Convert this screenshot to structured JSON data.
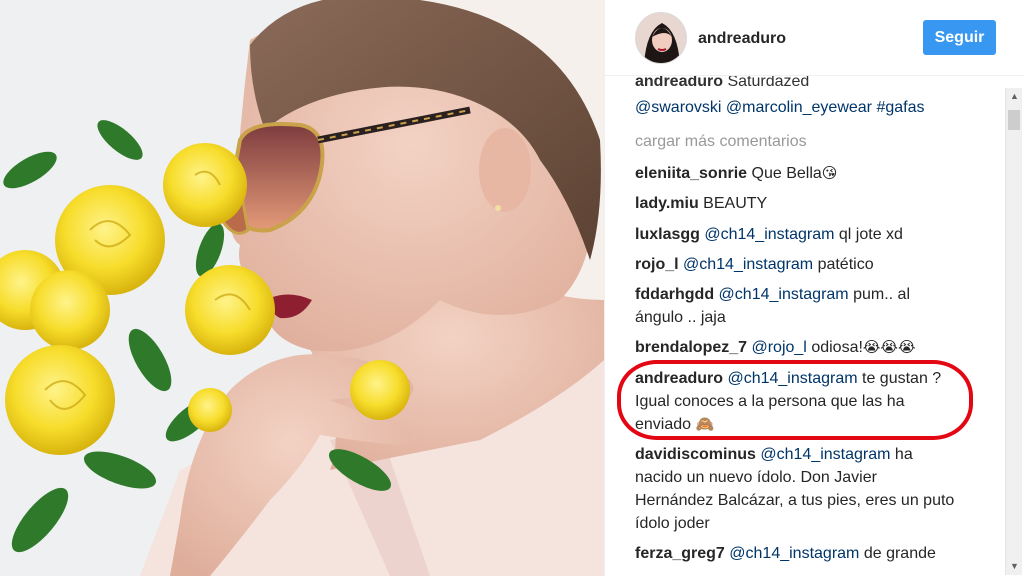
{
  "header": {
    "username": "andreaduro",
    "follow_label": "Seguir"
  },
  "caption_top": {
    "username": "andreaduro",
    "text": "Saturdazed ",
    "mentions": "@swarovski @marcolin_eyewear #gafas"
  },
  "load_more": "cargar más comentarios",
  "comments": [
    {
      "user": "eleniita_sonrie",
      "text": "Que Bella",
      "emoji": "😘"
    },
    {
      "user": "lady.miu",
      "text": "BEAUTY"
    },
    {
      "user": "luxlasgg",
      "mention": "@ch14_instagram",
      "text": "ql jote xd"
    },
    {
      "user": "rojo_l",
      "mention": "@ch14_instagram",
      "text": "patético"
    },
    {
      "user": "fddarhgdd",
      "mention": "@ch14_instagram",
      "text": "pum.. al",
      "text2": "ángulo .. jaja"
    },
    {
      "user": "brendalopez_7",
      "mention": "@rojo_l",
      "text": "odiosa!",
      "emoji": "😭😭😭"
    },
    {
      "user": "andreaduro",
      "mention": "@ch14_instagram",
      "text": "te gustan ?",
      "text2": "Igual conoces a la persona que las ha",
      "text3": "enviado",
      "emoji": "🙈"
    },
    {
      "user": "davidiscominus",
      "mention": "@ch14_instagram",
      "text": "ha",
      "text2": "nacido un nuevo ídolo. Don Javier",
      "text3": "Hernández Balcázar, a tus pies, eres un puto",
      "text4": "ídolo joder"
    },
    {
      "user": "ferza_greg7",
      "mention": "@ch14_instagram",
      "text": "de grande"
    }
  ],
  "icons": {
    "scroll_up": "scroll-up-arrow-icon",
    "scroll_down": "scroll-down-arrow-icon"
  },
  "colors": {
    "follow_button": "#3897f0",
    "mention": "#003569",
    "highlight": "#e30613",
    "load_more": "#999999"
  }
}
